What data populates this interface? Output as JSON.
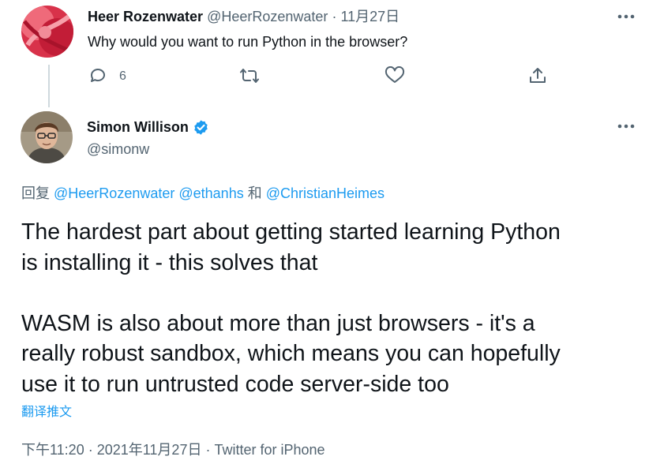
{
  "parent_tweet": {
    "display_name": "Heer Rozenwater",
    "handle": "@HeerRozenwater",
    "separator": "·",
    "date": "11月27日",
    "text": "Why would you want to run Python in the browser?",
    "reply_count": "6",
    "avatar_icon": "red-rose-avatar"
  },
  "main_tweet": {
    "display_name": "Simon Willison",
    "handle": "@simonw",
    "verified_icon": "verified-badge-icon",
    "reply_prefix": "回复",
    "reply_mentions": [
      "@HeerRozenwater",
      "@ethanhs",
      "@ChristianHeimes"
    ],
    "reply_conjunction": "和",
    "body_paragraph_1_line_1": "The hardest part about getting started learning Python",
    "body_paragraph_1_line_2": "is installing it - this solves that",
    "body_paragraph_2_line_1": "WASM is also about more than just browsers - it's a",
    "body_paragraph_2_line_2": "really robust sandbox, which means you can hopefully",
    "body_paragraph_2_line_3": "use it to run untrusted code server-side too",
    "translate_label": "翻译推文",
    "timestamp": "下午11:20 · 2021年11月27日 · Twitter for iPhone"
  },
  "colors": {
    "text": "#0f1419",
    "muted": "#536471",
    "link": "#1d9bf0",
    "verified": "#1d9bf0",
    "thread_line": "#cfd9de"
  }
}
